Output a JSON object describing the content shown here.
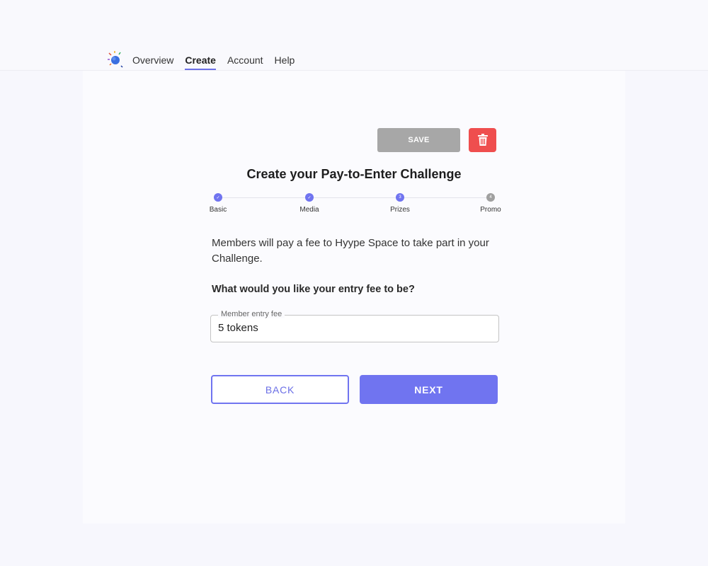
{
  "nav": {
    "logo_icon": "sparkle-globe-logo",
    "items": [
      {
        "label": "Overview",
        "active": false
      },
      {
        "label": "Create",
        "active": true
      },
      {
        "label": "Account",
        "active": false
      },
      {
        "label": "Help",
        "active": false
      }
    ]
  },
  "toolbar": {
    "save_label": "SAVE",
    "delete_icon": "trash-icon"
  },
  "page": {
    "title": "Create your Pay-to-Enter Challenge"
  },
  "stepper": {
    "steps": [
      {
        "label": "Basic",
        "status": "done",
        "marker": "✓"
      },
      {
        "label": "Media",
        "status": "done",
        "marker": "✓"
      },
      {
        "label": "Prizes",
        "status": "current",
        "marker": "3"
      },
      {
        "label": "Promo",
        "status": "todo",
        "marker": "4"
      }
    ]
  },
  "content": {
    "description": "Members will pay a fee to Hyype Space to take part in your Challenge.",
    "question": "What would you like your entry fee to be?"
  },
  "entry_fee": {
    "label": "Member entry fee",
    "value": "5 tokens"
  },
  "actions": {
    "back_label": "BACK",
    "next_label": "NEXT"
  },
  "colors": {
    "accent": "#7074f0",
    "danger": "#ef4e4e",
    "disabled": "#a7a7a7"
  }
}
